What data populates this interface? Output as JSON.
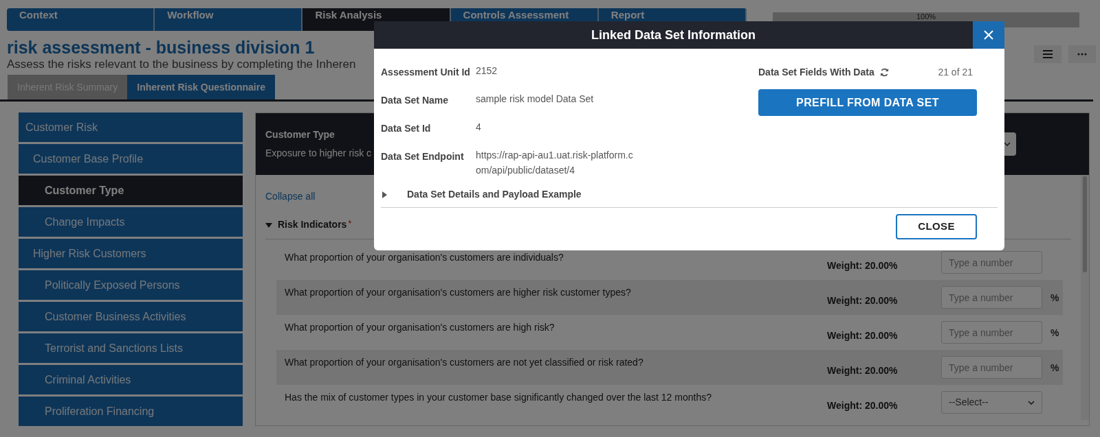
{
  "steps": [
    {
      "label": "Context",
      "selected": false
    },
    {
      "label": "Workflow",
      "selected": false
    },
    {
      "label": "Risk Analysis",
      "selected": true
    },
    {
      "label": "Controls Assessment",
      "selected": false
    },
    {
      "label": "Report",
      "selected": false
    }
  ],
  "progress": {
    "level": 1,
    "reading": "100%"
  },
  "page": {
    "title": "risk assessment - business division 1",
    "subtitle": "Assess the risks relevant to the business by completing the Inheren"
  },
  "toolbar": [
    {
      "kind": "menu"
    },
    {
      "kind": "more"
    }
  ],
  "tabs": [
    {
      "label": "Inherent Risk Summary",
      "selected": false
    },
    {
      "label": "Inherent Risk Questionnaire",
      "selected": true
    }
  ],
  "sidebar": {
    "items": [
      {
        "label": "Customer Risk",
        "selected": false,
        "children": [
          {
            "label": "Customer Base Profile",
            "selected": false,
            "children": [
              {
                "label": "Customer Type",
                "selected": true
              },
              {
                "label": "Change Impacts",
                "selected": false
              }
            ]
          },
          {
            "label": "Higher Risk Customers",
            "selected": false,
            "children": [
              {
                "label": "Politically Exposed Persons",
                "selected": false
              },
              {
                "label": "Customer Business Activities",
                "selected": false
              },
              {
                "label": "Terrorist and Sanctions Lists",
                "selected": false
              },
              {
                "label": "Criminal Activities",
                "selected": false
              },
              {
                "label": "Proliferation Financing",
                "selected": false
              }
            ]
          }
        ]
      }
    ]
  },
  "section": {
    "title": "Customer Type",
    "description": "Exposure to higher risk c",
    "collapse_link": "Collapse all",
    "group": {
      "label": "Risk Indicators",
      "required_mark": "*",
      "expanded": true
    },
    "questions": [
      {
        "text": "What proportion of your organisation's customers are individuals?",
        "weight": "Weight: 20.00%",
        "kind": "number",
        "placeholder": "Type a number"
      },
      {
        "text": "What proportion of your organisation's customers are higher risk customer types?",
        "weight": "Weight: 20.00%",
        "kind": "number",
        "placeholder": "Type a number",
        "unit": "%"
      },
      {
        "text": "What proportion of your organisation's customers are high risk?",
        "weight": "Weight: 20.00%",
        "kind": "number",
        "placeholder": "Type a number",
        "unit": "%"
      },
      {
        "text": "What proportion of your organisation's customers are not yet classified or risk rated?",
        "weight": "Weight: 20.00%",
        "kind": "number",
        "placeholder": "Type a number",
        "unit": "%"
      },
      {
        "text": "Has the mix of customer types in your customer base significantly changed over the last 12 months?",
        "weight": "Weight: 20.00%",
        "kind": "select",
        "value": "--Select--"
      }
    ]
  },
  "modal": {
    "title": "Linked Data Set Information",
    "fields": [
      {
        "label": "Assessment Unit Id",
        "value": "2152"
      },
      {
        "label": "Data Set Name",
        "value": "sample risk model Data Set"
      },
      {
        "label": "Data Set Id",
        "value": "4"
      },
      {
        "label": "Data Set Endpoint",
        "value": "https://rap-api-au1.uat.risk-platform.com/api/public/dataset/4"
      }
    ],
    "fields_with_data": {
      "label": "Data Set Fields With Data",
      "value": "21 of 21"
    },
    "prefill_button": "PREFILL FROM DATA SET",
    "details": {
      "label": "Data Set Details and Payload Example",
      "expanded": false
    },
    "close_button": "CLOSE"
  }
}
